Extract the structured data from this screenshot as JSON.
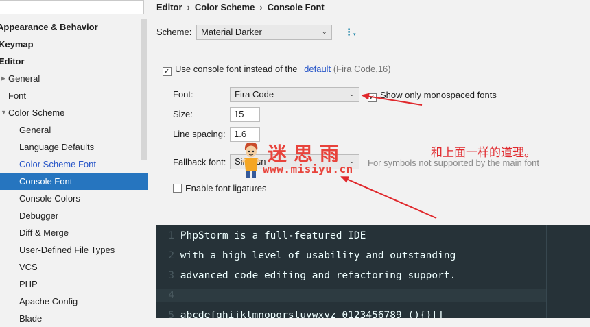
{
  "nav": {
    "search_value": "",
    "items": [
      {
        "label": "Appearance & Behavior"
      },
      {
        "label": "Keymap"
      },
      {
        "label": "Editor"
      },
      {
        "label": "General"
      },
      {
        "label": "Font"
      },
      {
        "label": "Color Scheme"
      },
      {
        "label": "General"
      },
      {
        "label": "Language Defaults"
      },
      {
        "label": "Color Scheme Font"
      },
      {
        "label": "Console Font"
      },
      {
        "label": "Console Colors"
      },
      {
        "label": "Debugger"
      },
      {
        "label": "Diff & Merge"
      },
      {
        "label": "User-Defined File Types"
      },
      {
        "label": "VCS"
      },
      {
        "label": "PHP"
      },
      {
        "label": "Apache Config"
      },
      {
        "label": "Blade"
      }
    ]
  },
  "breadcrumb": [
    "Editor",
    "Color Scheme",
    "Console Font"
  ],
  "breadcrumb_separator": "›",
  "scheme": {
    "label": "Scheme:",
    "value": "Material Darker"
  },
  "use_console_font": {
    "checked": true,
    "label": "Use console font instead of the",
    "link": "default",
    "detail": "(Fira Code,16)"
  },
  "font": {
    "label": "Font:",
    "value": "Fira Code"
  },
  "show_monospaced": {
    "checked": true,
    "label": "Show only monospaced fonts"
  },
  "size": {
    "label": "Size:",
    "value": "15"
  },
  "line_spacing": {
    "label": "Line spacing:",
    "value": "1.6"
  },
  "fallback": {
    "label": "Fallback font:",
    "value": "SimSun",
    "hint": "For symbols not supported by the main font"
  },
  "ligatures": {
    "checked": false,
    "label": "Enable font ligatures"
  },
  "preview": {
    "lines": [
      {
        "num": "1",
        "text": "PhpStorm is a full-featured IDE"
      },
      {
        "num": "2",
        "text": "with a high level of usability and outstanding"
      },
      {
        "num": "3",
        "text": "advanced code editing and refactoring support."
      },
      {
        "num": "4",
        "text": ""
      },
      {
        "num": "5",
        "text": "abcdefghijklmnopqrstuvwxyz 0123456789 (){}[]"
      }
    ],
    "colors": {
      "background": "#263238",
      "text": "#eeffff",
      "line_number": "#4a5a60"
    }
  },
  "annotations": {
    "watermark_cn": "迷思雨",
    "watermark_url": "www.misiyu.cn",
    "note": "和上面一样的道理。",
    "arrow_color": "#e0282c"
  },
  "colors": {
    "selection": "#2675bf",
    "link": "#2856c8",
    "accent_icon": "#0f7ea3"
  }
}
